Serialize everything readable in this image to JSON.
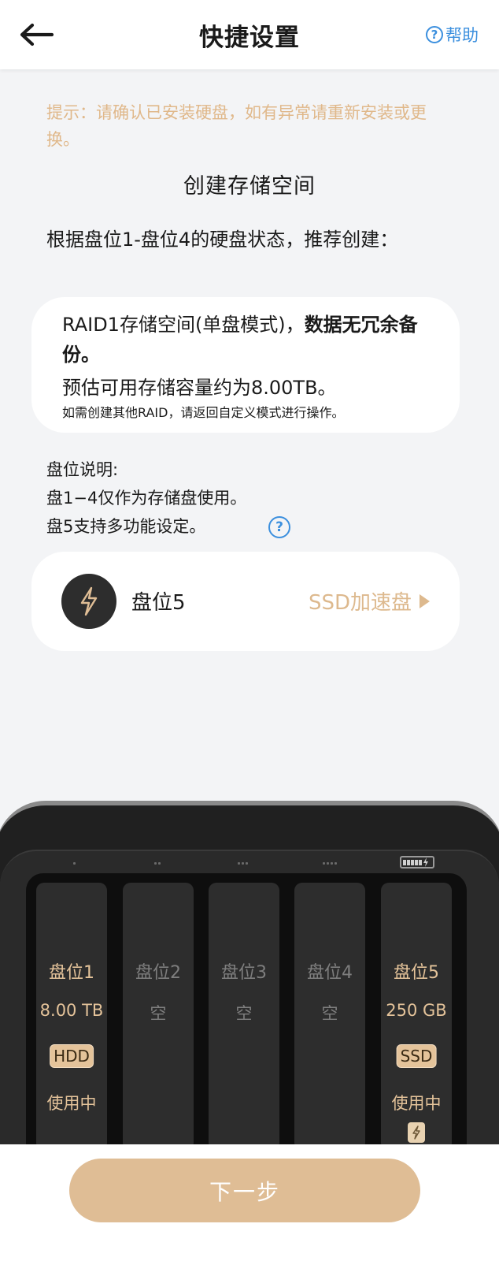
{
  "header": {
    "title": "快捷设置",
    "help_label": "帮助",
    "help_icon": "?"
  },
  "hint": "提示：请确认已安装硬盘，如有异常请重新安装或更换。",
  "section_title": "创建存储空间",
  "recommend_text": "根据盘位1-盘位4的硬盘状态，推荐创建：",
  "raid_card": {
    "mode_text": "RAID1存储空间(单盘模式)，",
    "warning": "数据无冗余备份。",
    "capacity": "预估可用存储容量约为8.00TB。",
    "note": "如需创建其他RAID，请返回自定义模式进行操作。"
  },
  "slot_desc": {
    "heading": "盘位说明:",
    "line1": "盘1−4仅作为存储盘使用。",
    "line2": "盘5支持多功能设定。",
    "info_icon": "?"
  },
  "slot5": {
    "label": "盘位5",
    "mode": "SSD加速盘"
  },
  "bays": [
    {
      "name": "盘位1",
      "size": "8.00 TB",
      "type": "HDD",
      "status": "使用中"
    },
    {
      "name": "盘位2",
      "size": "空"
    },
    {
      "name": "盘位3",
      "size": "空"
    },
    {
      "name": "盘位4",
      "size": "空"
    },
    {
      "name": "盘位5",
      "size": "250 GB",
      "type": "SSD",
      "status": "使用中"
    }
  ],
  "next_button": "下一步",
  "colors": {
    "accent_gold": "#dfbd95",
    "help_blue": "#3b8fde",
    "hint_text": "#e0b88a"
  }
}
